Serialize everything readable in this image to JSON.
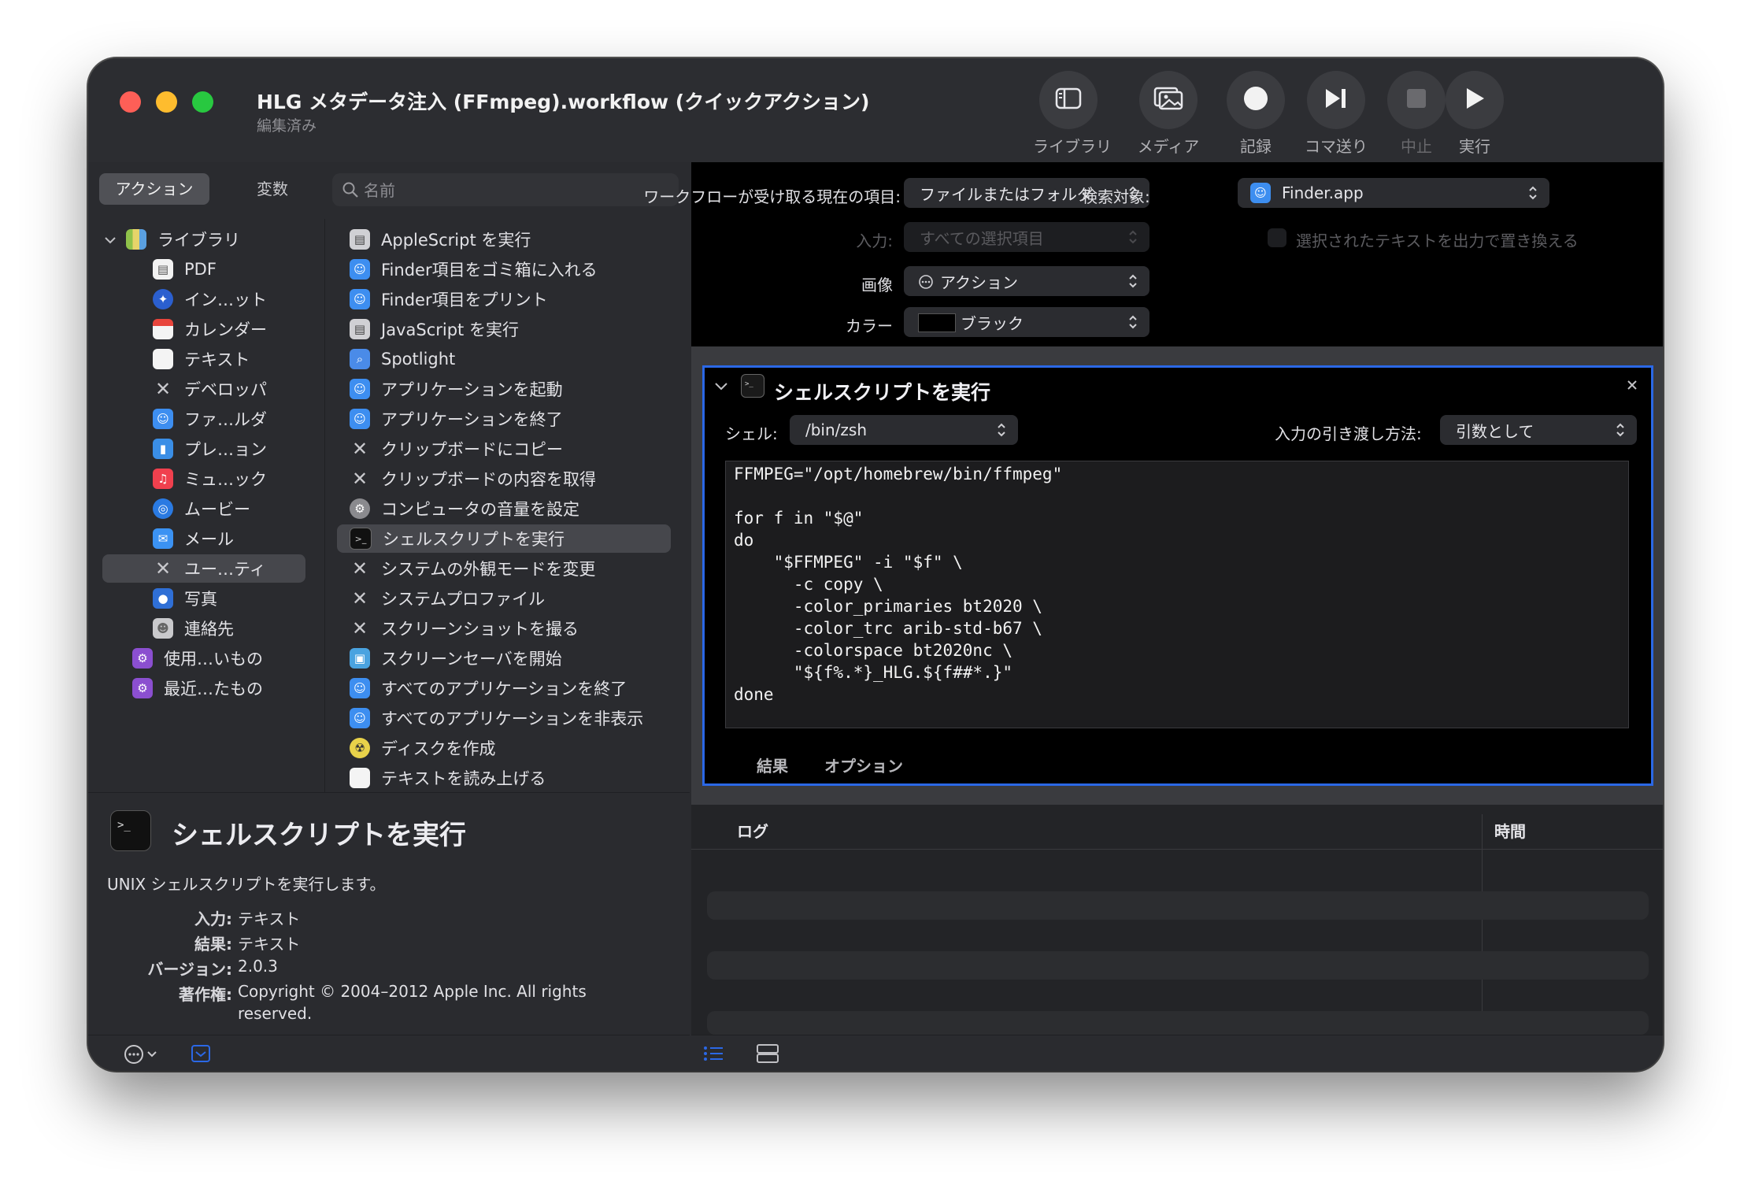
{
  "window": {
    "title": "HLG メタデータ注入 (FFmpeg).workflow (クイックアクション)",
    "subtitle": "編集済み"
  },
  "toolbar": {
    "library": "ライブラリ",
    "media": "メディア",
    "record": "記録",
    "step": "コマ送り",
    "stop": "中止",
    "run": "実行"
  },
  "left": {
    "tabs": {
      "actions": "アクション",
      "variables": "変数"
    },
    "search_placeholder": "名前",
    "library": {
      "root": "ライブラリ",
      "items": [
        "PDF",
        "イン…ット",
        "カレンダー",
        "テキスト",
        "デベロッパ",
        "ファ…ルダ",
        "プレ…ョン",
        "ミュ…ック",
        "ムービー",
        "メール",
        "ユー…ティ",
        "写真",
        "連絡先"
      ],
      "extra": [
        "使用…いもの",
        "最近…たもの"
      ]
    },
    "actions": [
      "AppleScript を実行",
      "Finder項目をゴミ箱に入れる",
      "Finder項目をプリント",
      "JavaScript を実行",
      "Spotlight",
      "アプリケーションを起動",
      "アプリケーションを終了",
      "クリップボードにコピー",
      "クリップボードの内容を取得",
      "コンピュータの音量を設定",
      "シェルスクリプトを実行",
      "システムの外観モードを変更",
      "システムプロファイル",
      "スクリーンショットを撮る",
      "スクリーンセーバを開始",
      "すべてのアプリケーションを終了",
      "すべてのアプリケーションを非表示",
      "ディスクを作成",
      "テキストを読み上げる"
    ],
    "description": {
      "title": "シェルスクリプトを実行",
      "summary": "UNIX シェルスクリプトを実行します。",
      "input_label": "入力:",
      "input_value": "テキスト",
      "result_label": "結果:",
      "result_value": "テキスト",
      "version_label": "バージョン:",
      "version_value": "2.0.3",
      "copyright_label": "著作権:",
      "copyright_line1": "Copyright © 2004–2012 Apple Inc.  All rights",
      "copyright_line2": "reserved."
    }
  },
  "workflow": {
    "receives_label": "ワークフローが受け取る現在の項目:",
    "receives_value": "ファイルまたはフォルダ",
    "in_label": "検索対象:",
    "in_value": "Finder.app",
    "input_label": "入力:",
    "input_value": "すべての選択項目",
    "replace_label": "選択されたテキストを出力で置き換える",
    "image_label": "画像",
    "image_value": "アクション",
    "color_label": "カラー",
    "color_value": "ブラック"
  },
  "action": {
    "title": "シェルスクリプトを実行",
    "shell_label": "シェル:",
    "shell_value": "/bin/zsh",
    "pass_label": "入力の引き渡し方法:",
    "pass_value": "引数として",
    "code": "FFMPEG=\"/opt/homebrew/bin/ffmpeg\"\n\nfor f in \"$@\"\ndo\n    \"$FFMPEG\" -i \"$f\" \\\n      -c copy \\\n      -color_primaries bt2020 \\\n      -color_trc arib-std-b67 \\\n      -colorspace bt2020nc \\\n      \"${f%.*}_HLG.${f##*.}\"\ndone",
    "tab_results": "結果",
    "tab_options": "オプション"
  },
  "log": {
    "col_log": "ログ",
    "col_time": "時間"
  },
  "colors": {
    "accent": "#2b68e6",
    "selection": "#46474c"
  }
}
